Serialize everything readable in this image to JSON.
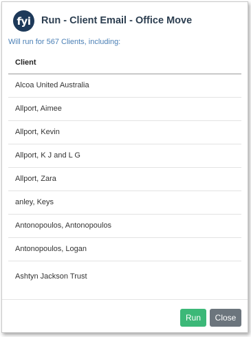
{
  "dialog": {
    "logo_text": "fyi",
    "title": "Run - Client Email - Office Move",
    "subtitle": "Will run for 567 Clients, including:"
  },
  "table": {
    "header": "Client",
    "rows": [
      "Alcoa United Australia",
      "Allport, Aimee",
      "Allport, Kevin",
      "Allport, K J and L G",
      "Allport, Zara",
      "anley, Keys",
      "Antonopoulos, Antonopoulos",
      "Antonopoulos, Logan",
      "Ashtyn Jackson Trust"
    ]
  },
  "footer": {
    "run_label": "Run",
    "close_label": "Close"
  },
  "colors": {
    "run_button": "#3cb878",
    "close_button": "#6c757d",
    "title": "#2c3e50",
    "subtitle": "#4a7fb5",
    "logo_bg": "#1e3a5a"
  }
}
